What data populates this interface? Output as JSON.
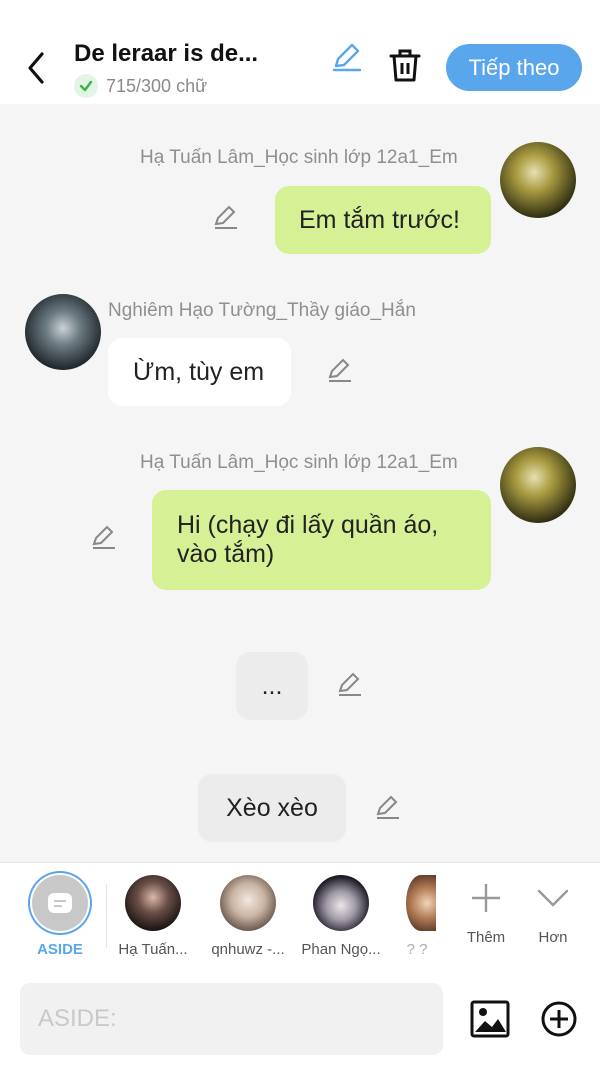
{
  "header": {
    "title": "De leraar is de...",
    "count": "715/300 chữ",
    "next_label": "Tiếp theo"
  },
  "messages": [
    {
      "speaker": "Hạ Tuấn Lâm_Học sinh lớp 12a1_Em",
      "text": "Em tắm trước!",
      "side": "right"
    },
    {
      "speaker": "Nghiêm Hạo Tường_Thầy giáo_Hắn",
      "text": "Ừm, tùy em",
      "side": "left"
    },
    {
      "speaker": "Hạ Tuấn Lâm_Học sinh lớp 12a1_Em",
      "text_line1": "Hi (chạy đi lấy quần áo,",
      "text_line2": "vào tắm)",
      "side": "right"
    },
    {
      "text": "...",
      "side": "aside"
    },
    {
      "text": "Xèo xèo",
      "side": "aside"
    }
  ],
  "characters": [
    {
      "label": "ASIDE",
      "selected": true
    },
    {
      "label": "Hạ Tuấn..."
    },
    {
      "label": "qnhuwz -..."
    },
    {
      "label": "Phan Ngọ..."
    },
    {
      "label": "? ?"
    }
  ],
  "actions": {
    "add_label": "Thêm",
    "more_label": "Hơn"
  },
  "composer": {
    "placeholder": "ASIDE:"
  },
  "colors": {
    "accent": "#5aa6ec",
    "bubble_green": "#d6f195",
    "success": "#39b54a"
  }
}
